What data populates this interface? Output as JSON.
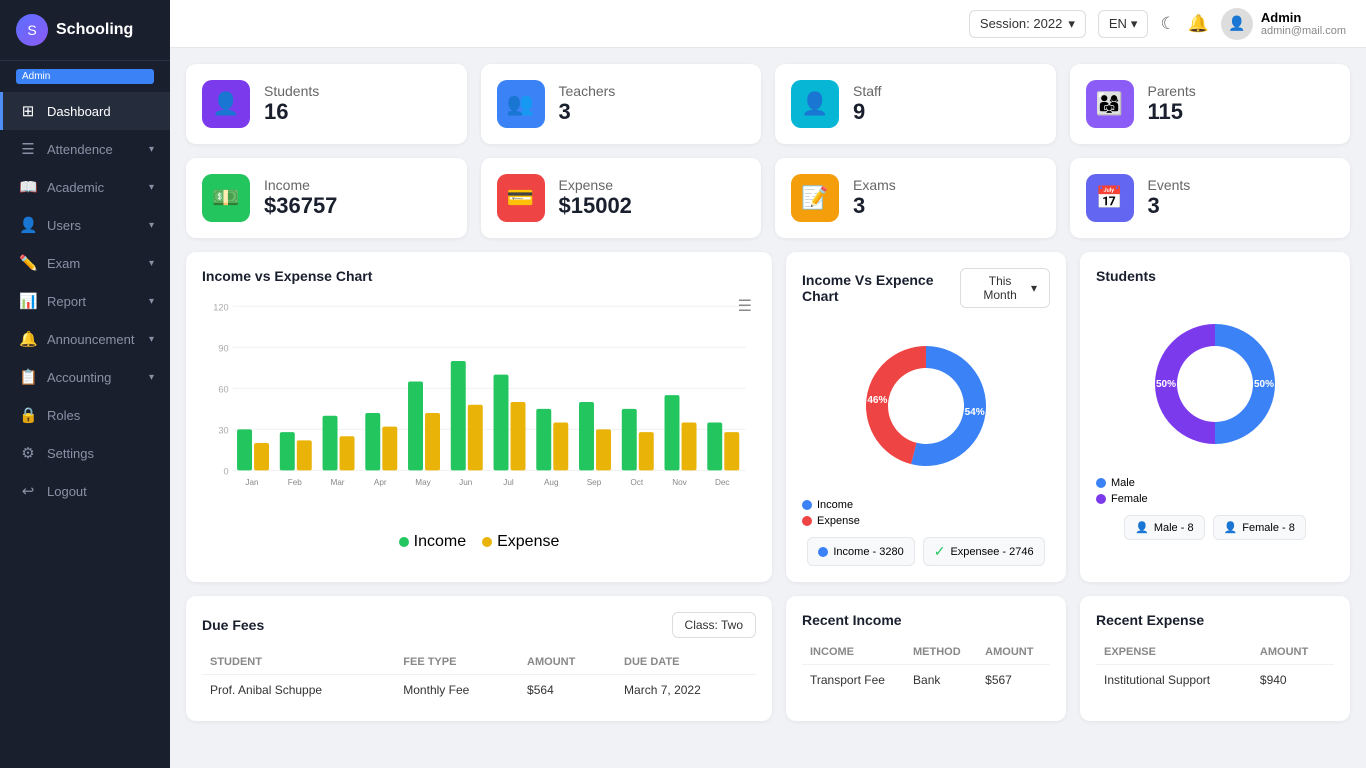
{
  "app": {
    "name": "Schooling",
    "admin_badge": "Admin"
  },
  "header": {
    "session_label": "Session: 2022",
    "lang": "EN",
    "user_name": "Admin",
    "user_email": "admin@mail.com"
  },
  "sidebar": {
    "items": [
      {
        "id": "dashboard",
        "label": "Dashboard",
        "icon": "⊞",
        "active": true,
        "has_arrow": false
      },
      {
        "id": "attendance",
        "label": "Attendence",
        "icon": "☰",
        "active": false,
        "has_arrow": true
      },
      {
        "id": "academic",
        "label": "Academic",
        "icon": "📖",
        "active": false,
        "has_arrow": true
      },
      {
        "id": "users",
        "label": "Users",
        "icon": "👤",
        "active": false,
        "has_arrow": true
      },
      {
        "id": "exam",
        "label": "Exam",
        "icon": "✏️",
        "active": false,
        "has_arrow": true
      },
      {
        "id": "report",
        "label": "Report",
        "icon": "📊",
        "active": false,
        "has_arrow": true
      },
      {
        "id": "announcement",
        "label": "Announcement",
        "icon": "🔔",
        "active": false,
        "has_arrow": true
      },
      {
        "id": "accounting",
        "label": "Accounting",
        "icon": "📋",
        "active": false,
        "has_arrow": true
      },
      {
        "id": "roles",
        "label": "Roles",
        "icon": "🔒",
        "active": false,
        "has_arrow": false
      },
      {
        "id": "settings",
        "label": "Settings",
        "icon": "⚙",
        "active": false,
        "has_arrow": false
      },
      {
        "id": "logout",
        "label": "Logout",
        "icon": "↩",
        "active": false,
        "has_arrow": false
      }
    ]
  },
  "stats": [
    {
      "id": "students",
      "label": "Students",
      "value": "16",
      "icon": "👤",
      "bg": "#7c3aed"
    },
    {
      "id": "teachers",
      "label": "Teachers",
      "value": "3",
      "icon": "👥",
      "bg": "#3b82f6"
    },
    {
      "id": "staff",
      "label": "Staff",
      "value": "9",
      "icon": "👤",
      "bg": "#06b6d4"
    },
    {
      "id": "parents",
      "label": "Parents",
      "value": "115",
      "icon": "👨‍👩‍👧",
      "bg": "#8b5cf6"
    },
    {
      "id": "income",
      "label": "Income",
      "value": "$36757",
      "icon": "💵",
      "bg": "#22c55e"
    },
    {
      "id": "expense",
      "label": "Expense",
      "value": "$15002",
      "icon": "💳",
      "bg": "#ef4444"
    },
    {
      "id": "exams",
      "label": "Exams",
      "value": "3",
      "icon": "📝",
      "bg": "#f59e0b"
    },
    {
      "id": "events",
      "label": "Events",
      "value": "3",
      "icon": "📅",
      "bg": "#6366f1"
    }
  ],
  "bar_chart": {
    "title": "Income vs Expense Chart",
    "months": [
      "Jan",
      "Feb",
      "Mar",
      "Apr",
      "May",
      "Jun",
      "Jul",
      "Aug",
      "Sep",
      "Oct",
      "Nov",
      "Dec"
    ],
    "income_color": "#22c55e",
    "expense_color": "#eab308",
    "legend_income": "Income",
    "legend_expense": "Expense",
    "income_values": [
      30,
      28,
      40,
      42,
      65,
      80,
      70,
      45,
      50,
      45,
      55,
      35
    ],
    "expense_values": [
      20,
      22,
      25,
      32,
      42,
      48,
      50,
      35,
      30,
      28,
      35,
      28
    ]
  },
  "donut_income_expense": {
    "title": "Income Vs Expence Chart",
    "filter_btn": "This Month",
    "income_pct": 54.0,
    "expense_pct": 46.0,
    "income_color": "#3b82f6",
    "expense_color": "#ef4444",
    "legend_income": "Income",
    "legend_expense": "Expense",
    "stat_income": "Income - 3280",
    "stat_expense": "Expensee - 2746"
  },
  "donut_students": {
    "title": "Students",
    "male_pct": 50.0,
    "female_pct": 50.0,
    "male_color": "#3b82f6",
    "female_color": "#7c3aed",
    "legend_male": "Male",
    "legend_female": "Female",
    "stat_male": "Male - 8",
    "stat_female": "Female - 8"
  },
  "due_fees": {
    "title": "Due Fees",
    "class_label": "Class: Two",
    "columns": [
      "Student",
      "Fee Type",
      "Amount",
      "Due Date"
    ],
    "rows": [
      {
        "student": "Prof. Anibal Schuppe",
        "fee_type": "Monthly Fee",
        "amount": "$564",
        "due_date": "March 7, 2022"
      }
    ]
  },
  "recent_income": {
    "title": "Recent Income",
    "columns": [
      "Income",
      "Method",
      "Amount"
    ],
    "rows": [
      {
        "income": "Transport Fee",
        "method": "Bank",
        "amount": "$567"
      }
    ]
  },
  "recent_expense": {
    "title": "Recent Expense",
    "columns": [
      "Expense",
      "Amount"
    ],
    "rows": [
      {
        "expense": "Institutional Support",
        "amount": "$940"
      }
    ]
  }
}
